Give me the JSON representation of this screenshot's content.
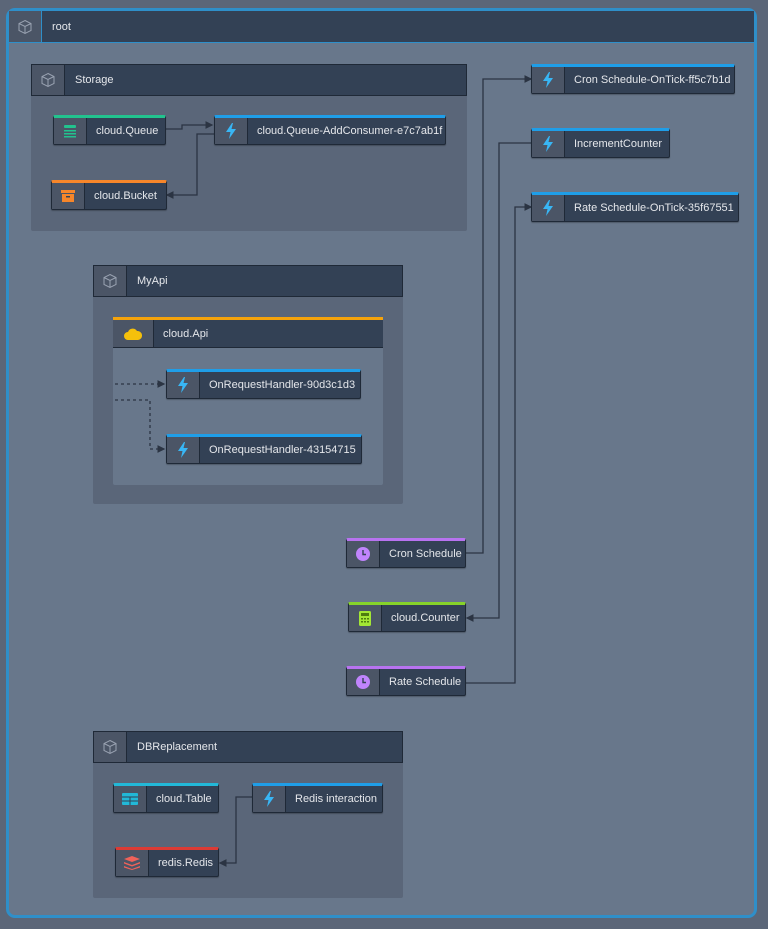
{
  "root": {
    "label": "root",
    "icon": "cube-icon"
  },
  "colors": {
    "function": "#1f9ee8",
    "queue": "#22c38e",
    "bucket": "#f7862a",
    "api": "#f5a30b",
    "schedule": "#b873f0",
    "counter": "#86d32a",
    "table": "#22b8d8",
    "redis": "#dc3b35",
    "frame": "#2f8fc9"
  },
  "groups": {
    "storage": {
      "label": "Storage",
      "icon": "cube-icon"
    },
    "myapi": {
      "label": "MyApi",
      "icon": "cube-icon"
    },
    "dbreplacement": {
      "label": "DBReplacement",
      "icon": "cube-icon"
    }
  },
  "nodes": {
    "queue": {
      "label": "cloud.Queue",
      "icon": "queue-icon"
    },
    "queue_consumer": {
      "label": "cloud.Queue-AddConsumer-e7c7ab1f",
      "icon": "lightning-icon"
    },
    "bucket": {
      "label": "cloud.Bucket",
      "icon": "bucket-icon"
    },
    "api": {
      "label": "cloud.Api",
      "icon": "cloud-icon"
    },
    "handler1": {
      "label": "OnRequestHandler-90d3c1d3",
      "icon": "lightning-icon"
    },
    "handler2": {
      "label": "OnRequestHandler-43154715",
      "icon": "lightning-icon"
    },
    "cron_tick": {
      "label": "Cron Schedule-OnTick-ff5c7b1d",
      "icon": "lightning-icon"
    },
    "increment": {
      "label": "IncrementCounter",
      "icon": "lightning-icon"
    },
    "rate_tick": {
      "label": "Rate Schedule-OnTick-35f67551",
      "icon": "lightning-icon"
    },
    "cron": {
      "label": "Cron Schedule",
      "icon": "clock-icon"
    },
    "counter": {
      "label": "cloud.Counter",
      "icon": "calculator-icon"
    },
    "rate": {
      "label": "Rate Schedule",
      "icon": "clock-icon"
    },
    "table": {
      "label": "cloud.Table",
      "icon": "table-icon"
    },
    "redis_fn": {
      "label": "Redis interaction",
      "icon": "lightning-icon"
    },
    "redis": {
      "label": "redis.Redis",
      "icon": "redis-icon"
    }
  }
}
